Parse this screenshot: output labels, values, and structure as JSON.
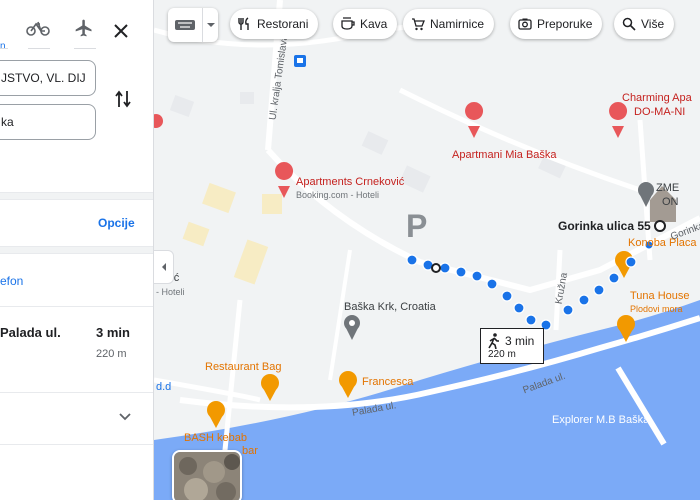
{
  "panel": {
    "mode_label": "n",
    "from_value": "JSTVO, VL. DIJ",
    "to_value": "ka",
    "options_label": "Opcije",
    "phone_label": "efon",
    "route": {
      "name": "Palada ul.",
      "time": "3 min",
      "distance": "220 m"
    }
  },
  "toolbar": {
    "chips": [
      "Restorani",
      "Kava",
      "Namirnice",
      "Preporuke",
      "Više"
    ]
  },
  "map": {
    "labels": {
      "charming_1": "Charming Apa",
      "charming_2": "DO-MA-NI",
      "mia": "Apartmani Mia Baška",
      "crnekovic": "Apartments Crneković",
      "booking": "Booking.com - Hoteli",
      "dest": "Gorinka ulica 55",
      "konoba": "Konoba Placa",
      "tuna": "Tuna House",
      "tuna_sub": "Plodovi mora",
      "baska": "Baška Krk, Croatia",
      "restaurant_bag": "Restaurant Bag",
      "francesca": "Francesca",
      "bash": "BASH kebab",
      "bash_sub": "bar",
      "explorer": "Explorer M.B Baška",
      "palada_1": "Palada ul.",
      "palada_2": "Palada ul.",
      "tomislava": "Ul. kralja Tomislava",
      "kruzna": "Kružna",
      "gorinka_road": "Gorinka",
      "orcic": "orčić",
      "hoteli": "- Hoteli",
      "dd": "d.d",
      "zme_1": "ZME",
      "zme_2": "ON"
    },
    "walk": {
      "time": "3 min",
      "distance": "220 m"
    },
    "parking": "P"
  },
  "colors": {
    "accent": "#1a73e8",
    "route_dot": "#1a73e8",
    "water": "#7baaf7",
    "poi": "#e8575a",
    "food": "#f29900"
  }
}
